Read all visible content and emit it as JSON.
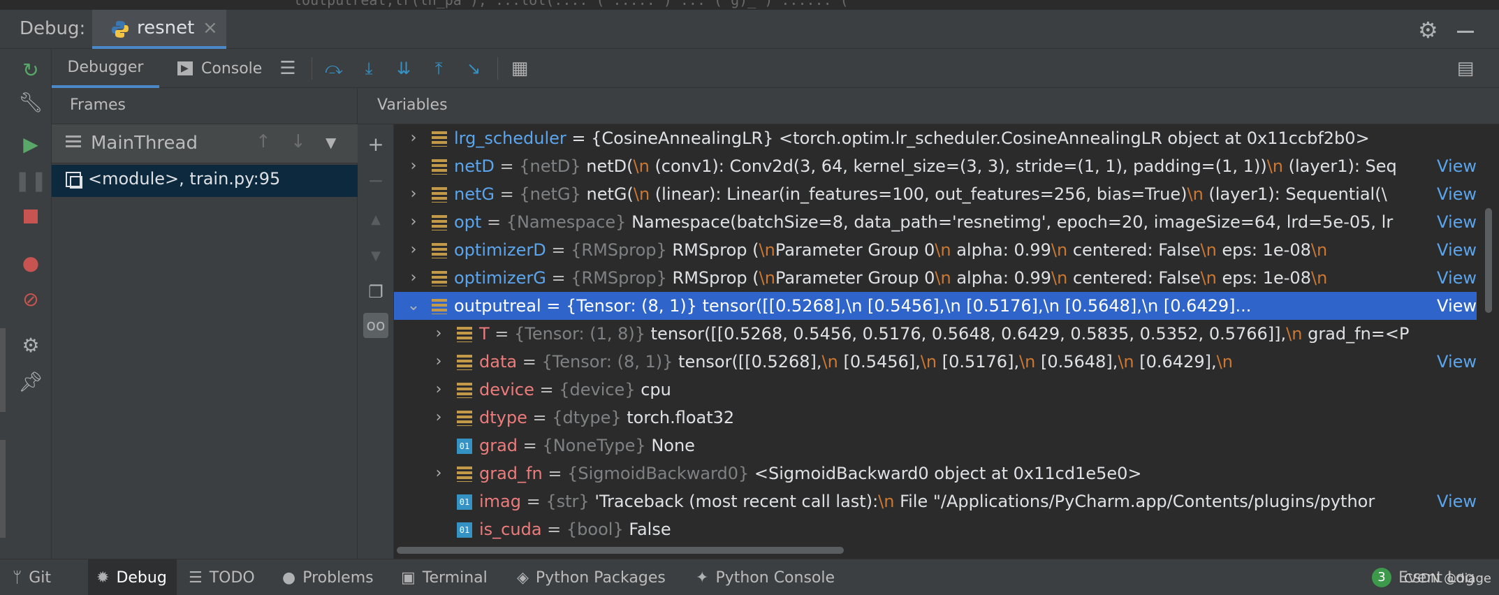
{
  "editor_fragment": "loutputreal,lr(ln_pa      ), ...lol(....  (  .....   )   ...  (  g)_ )  ......  (",
  "window": {
    "title": "Debug:",
    "run_tab": "resnet",
    "run_tab_close": "×"
  },
  "tabs": {
    "debugger": "Debugger",
    "console": "Console"
  },
  "frames": {
    "header": "Frames",
    "thread": "MainThread",
    "frame": "<module>, train.py:95"
  },
  "variables": {
    "header": "Variables",
    "view_label": "View",
    "rows": [
      {
        "expand": "›",
        "icon": "obj",
        "name": "lrg_scheduler",
        "type": "",
        "value": " = {CosineAnnealingLR} <torch.optim.lr_scheduler.CosineAnnealingLR object at 0x11ccbf2b0>",
        "has_view": false,
        "indent": 0
      },
      {
        "expand": "›",
        "icon": "obj",
        "name": "netD",
        "type": "{netD}",
        "value": " netD(\\n  (conv1): Conv2d(3, 64, kernel_size=(3, 3), stride=(1, 1), padding=(1, 1))\\n  (layer1): Seq",
        "has_view": true,
        "indent": 0
      },
      {
        "expand": "›",
        "icon": "obj",
        "name": "netG",
        "type": "{netG}",
        "value": " netG(\\n  (linear): Linear(in_features=100, out_features=256, bias=True)\\n  (layer1): Sequential(\\",
        "has_view": true,
        "indent": 0
      },
      {
        "expand": "›",
        "icon": "obj",
        "name": "opt",
        "type": "{Namespace}",
        "value": " Namespace(batchSize=8, data_path='resnetimg', epoch=20, imageSize=64, lrd=5e-05, lr",
        "has_view": true,
        "indent": 0
      },
      {
        "expand": "›",
        "icon": "obj",
        "name": "optimizerD",
        "type": "{RMSprop}",
        "value": " RMSprop (\\nParameter Group 0\\n    alpha: 0.99\\n    centered: False\\n    eps: 1e-08\\n",
        "has_view": true,
        "indent": 0
      },
      {
        "expand": "›",
        "icon": "obj",
        "name": "optimizerG",
        "type": "{RMSprop}",
        "value": " RMSprop (\\nParameter Group 0\\n    alpha: 0.99\\n    centered: False\\n    eps: 1e-08\\n",
        "has_view": true,
        "indent": 0
      },
      {
        "expand": "⌄",
        "icon": "obj",
        "name": "outputreal",
        "type": "",
        "value": " = {Tensor: (8, 1)} tensor([[0.5268],\\n        [0.5456],\\n        [0.5176],\\n        [0.5648],\\n        [0.6429]...",
        "has_view": true,
        "indent": 0,
        "selected": true
      },
      {
        "expand": "›",
        "icon": "obj",
        "name": "T",
        "type": "{Tensor: (1, 8)}",
        "value": " tensor([[0.5268, 0.5456, 0.5176, 0.5648, 0.6429, 0.5835, 0.5352, 0.5766]],\\n      grad_fn=<P",
        "has_view": false,
        "indent": 1
      },
      {
        "expand": "›",
        "icon": "obj",
        "name": "data",
        "type": "{Tensor: (8, 1)}",
        "value": " tensor([[0.5268],\\n        [0.5456],\\n        [0.5176],\\n        [0.5648],\\n        [0.6429],\\n",
        "has_view": true,
        "indent": 1
      },
      {
        "expand": "›",
        "icon": "obj",
        "name": "device",
        "type": "{device}",
        "value": " cpu",
        "has_view": false,
        "indent": 1
      },
      {
        "expand": "›",
        "icon": "obj",
        "name": "dtype",
        "type": "{dtype}",
        "value": " torch.float32",
        "has_view": false,
        "indent": 1
      },
      {
        "expand": "",
        "icon": "prim",
        "name": "grad",
        "type": "{NoneType}",
        "value": " None",
        "has_view": false,
        "indent": 1
      },
      {
        "expand": "›",
        "icon": "obj",
        "name": "grad_fn",
        "type": "{SigmoidBackward0}",
        "value": " <SigmoidBackward0 object at 0x11cd1e5e0>",
        "has_view": false,
        "indent": 1
      },
      {
        "expand": "",
        "icon": "prim",
        "name": "imag",
        "type": "{str}",
        "value": " 'Traceback (most recent call last):\\n  File \"/Applications/PyCharm.app/Contents/plugins/pythor",
        "has_view": true,
        "indent": 1
      },
      {
        "expand": "",
        "icon": "prim",
        "name": "is_cuda",
        "type": "{bool}",
        "value": " False",
        "has_view": false,
        "indent": 1
      }
    ]
  },
  "bottom_tabs": [
    {
      "label": "Git",
      "icon": "git-branch-icon",
      "glyph": "ᛘ"
    },
    {
      "label": "Debug",
      "icon": "bug-icon",
      "glyph": "✹",
      "active": true
    },
    {
      "label": "TODO",
      "icon": "list-icon",
      "glyph": "☰"
    },
    {
      "label": "Problems",
      "icon": "alert-icon",
      "glyph": "●"
    },
    {
      "label": "Terminal",
      "icon": "terminal-icon",
      "glyph": "▣"
    },
    {
      "label": "Python Packages",
      "icon": "layers-icon",
      "glyph": "◈"
    },
    {
      "label": "Python Console",
      "icon": "python-icon",
      "glyph": "✦"
    }
  ],
  "event_log": {
    "count": "3",
    "label": "Event Log"
  },
  "watermark": "CSDN @diage",
  "colors": {
    "accent": "#4a88c7",
    "selection": "#2f65ca",
    "name": "#5aa5ed",
    "newline": "#cc7832"
  }
}
